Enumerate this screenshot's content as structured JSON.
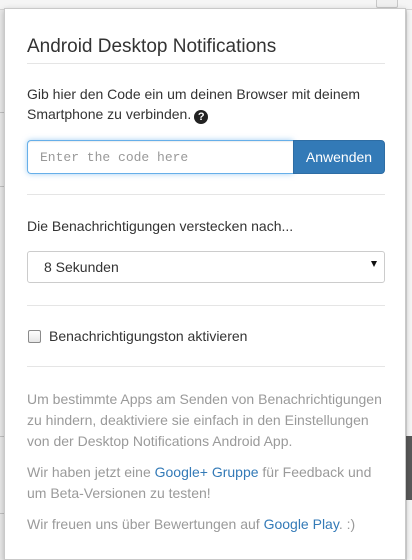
{
  "popup": {
    "title": "Android Desktop Notifications",
    "intro": {
      "text": "Gib hier den Code ein um deinen Browser mit deinem Smartphone zu verbinden.",
      "help_icon": "question-circle-icon"
    },
    "code_input": {
      "placeholder": "Enter the code here",
      "value": ""
    },
    "apply_button": "Anwenden",
    "hide_after": {
      "label": "Die Benachrichtigungen verstecken nach...",
      "selected": "8 Sekunden"
    },
    "sound_checkbox": {
      "label": "Benachrichtigungston aktivieren",
      "checked": false
    },
    "info": {
      "apps_text": "Um bestimmte Apps am Senden von Benachrichtigungen zu hindern, deaktiviere sie einfach in den Einstellungen von der Desktop Notifications Android App.",
      "group_prefix": "Wir haben jetzt eine ",
      "group_link": "Google+ Gruppe",
      "group_suffix": " für Feedback und um Beta-Versionen zu testen!",
      "rating_prefix": "Wir freuen uns über Bewertungen auf ",
      "rating_link": "Google Play",
      "rating_suffix": ". :)"
    }
  },
  "colors": {
    "accent": "#337ab7",
    "muted_text": "#9a9a9a",
    "text": "#333333"
  }
}
